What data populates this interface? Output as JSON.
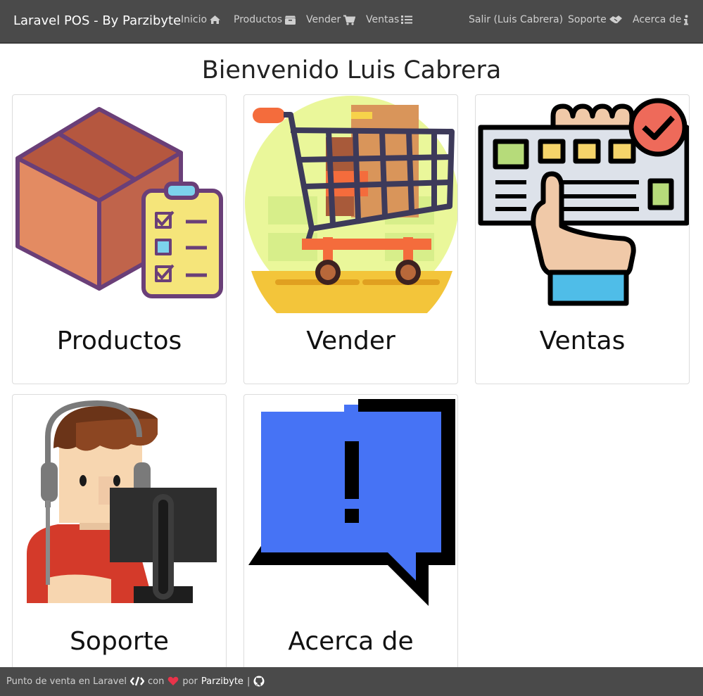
{
  "navbar": {
    "brand": "Laravel POS - By Parzibyte",
    "left_items": [
      {
        "label": "Inicio",
        "icon": "home-icon"
      },
      {
        "label": "Productos",
        "icon": "box-icon"
      },
      {
        "label": "Vender",
        "icon": "cart-icon"
      },
      {
        "label": "Ventas",
        "icon": "list-icon"
      }
    ],
    "right_items": [
      {
        "label": "Salir (Luis Cabrera)"
      },
      {
        "label": "Soporte",
        "icon": "handshake-icon"
      },
      {
        "label": "Acerca de",
        "icon": "info-icon"
      }
    ]
  },
  "main": {
    "title": "Bienvenido Luis Cabrera",
    "cards": [
      {
        "label": "Productos",
        "icon": "box-clipboard-icon"
      },
      {
        "label": "Vender",
        "icon": "shopping-cart-icon"
      },
      {
        "label": "Ventas",
        "icon": "payment-card-hand-icon"
      },
      {
        "label": "Soporte",
        "icon": "support-agent-icon"
      },
      {
        "label": "Acerca de",
        "icon": "exclamation-speech-icon"
      }
    ]
  },
  "footer": {
    "text_before": "Punto de venta en Laravel",
    "text_con": "con",
    "text_por": "por",
    "author": "Parzibyte",
    "separator": "|",
    "icons": [
      "code-icon",
      "heart-icon",
      "github-icon"
    ]
  },
  "colors": {
    "navbar_bg": "#4a4a4a",
    "nav_text": "#cfcfcf",
    "heart": "#e8334a",
    "card_border": "#dcdcdc"
  }
}
